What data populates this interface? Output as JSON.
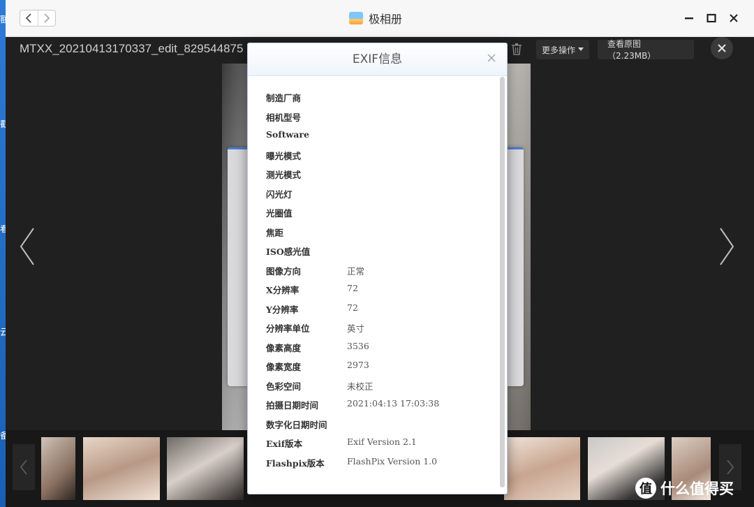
{
  "desktop": {
    "chars": [
      "额",
      "截",
      "看",
      "云",
      "备"
    ]
  },
  "window": {
    "title": "极相册",
    "nav": {
      "back": "‹",
      "forward": "›"
    }
  },
  "viewer": {
    "filename": "MTXX_20210413170337_edit_829544875",
    "more_actions": "更多操作",
    "view_original": "查看原图（2.23MB）"
  },
  "exif_dialog": {
    "title": "EXIF信息",
    "rows": [
      {
        "label": "制造厂商",
        "value": ""
      },
      {
        "label": "相机型号",
        "value": ""
      },
      {
        "label": "Software",
        "value": ""
      },
      {
        "label": "曝光模式",
        "value": ""
      },
      {
        "label": "测光模式",
        "value": ""
      },
      {
        "label": "闪光灯",
        "value": ""
      },
      {
        "label": "光圈值",
        "value": ""
      },
      {
        "label": "焦距",
        "value": ""
      },
      {
        "label": "ISO感光值",
        "value": ""
      },
      {
        "label": "图像方向",
        "value": "正常"
      },
      {
        "label": "X分辨率",
        "value": "72"
      },
      {
        "label": "Y分辨率",
        "value": "72"
      },
      {
        "label": "分辨率单位",
        "value": "英寸"
      },
      {
        "label": "像素高度",
        "value": "3536"
      },
      {
        "label": "像素宽度",
        "value": "2973"
      },
      {
        "label": "色彩空间",
        "value": "未校正"
      },
      {
        "label": "拍摄日期时间",
        "value": "2021:04:13 17:03:38"
      },
      {
        "label": "数字化日期时间",
        "value": ""
      },
      {
        "label": "Exif版本",
        "value": "Exif Version 2.1"
      },
      {
        "label": "Flashpix版本",
        "value": "FlashPix Version 1.0"
      }
    ]
  },
  "watermark": {
    "logo": "值",
    "text": "什么值得买"
  },
  "colors": {
    "accent": "#4a7bd6",
    "viewer_bg": "#202020",
    "dialog_border": "#b9c9df"
  }
}
